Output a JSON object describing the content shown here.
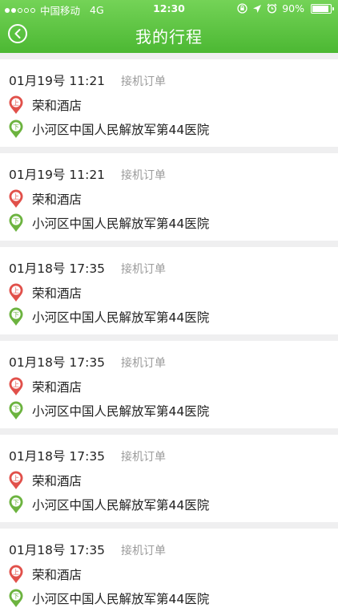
{
  "status_bar": {
    "carrier": "中国移动",
    "network": "4G",
    "time": "12:30",
    "battery_text": "90%",
    "battery_level": 0.9
  },
  "nav": {
    "title": "我的行程"
  },
  "icons": {
    "back": "back-arrow-icon",
    "pickup": "pickup-pin-icon",
    "dropoff": "dropoff-pin-icon"
  },
  "pin_labels": {
    "pickup": "上",
    "dropoff": "下"
  },
  "colors": {
    "header": "#4cb833",
    "pickup": "#e1504a",
    "dropoff": "#6cb33f"
  },
  "trips": [
    {
      "datetime": "01月19号 11:21",
      "type": "接机订单",
      "pickup": "荣和酒店",
      "dropoff": "小河区中国人民解放军第44医院"
    },
    {
      "datetime": "01月19号 11:21",
      "type": "接机订单",
      "pickup": "荣和酒店",
      "dropoff": "小河区中国人民解放军第44医院"
    },
    {
      "datetime": "01月18号 17:35",
      "type": "接机订单",
      "pickup": "荣和酒店",
      "dropoff": "小河区中国人民解放军第44医院"
    },
    {
      "datetime": "01月18号 17:35",
      "type": "接机订单",
      "pickup": "荣和酒店",
      "dropoff": "小河区中国人民解放军第44医院"
    },
    {
      "datetime": "01月18号 17:35",
      "type": "接机订单",
      "pickup": "荣和酒店",
      "dropoff": "小河区中国人民解放军第44医院"
    },
    {
      "datetime": "01月18号 17:35",
      "type": "接机订单",
      "pickup": "荣和酒店",
      "dropoff": "小河区中国人民解放军第44医院"
    }
  ]
}
